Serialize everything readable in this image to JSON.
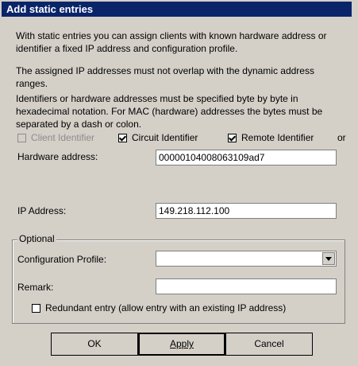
{
  "window": {
    "title": "Add static entries"
  },
  "description": [
    "With static entries you can assign clients with known hardware address or identifier a fixed IP address and configuration profile.",
    "The assigned IP addresses must not overlap with the dynamic address ranges.",
    "Identifiers or hardware addresses must be specified byte by byte in hexadecimal notation. For MAC (hardware) addresses the bytes must be separated by a dash or colon."
  ],
  "identifiers": {
    "client": {
      "label": "Client Identifier",
      "checked": false,
      "enabled": false
    },
    "circuit": {
      "label": "Circuit Identifier",
      "checked": true,
      "enabled": true
    },
    "remote": {
      "label": "Remote Identifier",
      "checked": true,
      "enabled": true
    },
    "or_label": "or"
  },
  "hardware_address": {
    "label": "Hardware address:",
    "value": "00000104008063109ad7"
  },
  "ip_address": {
    "label": "IP Address:",
    "value": "149.218.112.100"
  },
  "optional": {
    "title": "Optional",
    "config_profile": {
      "label": "Configuration Profile:",
      "value": ""
    },
    "remark": {
      "label": "Remark:",
      "value": ""
    },
    "redundant": {
      "label": "Redundant entry (allow entry with an existing IP address)",
      "checked": false
    }
  },
  "buttons": {
    "ok": "OK",
    "apply": "Apply",
    "cancel": "Cancel"
  }
}
